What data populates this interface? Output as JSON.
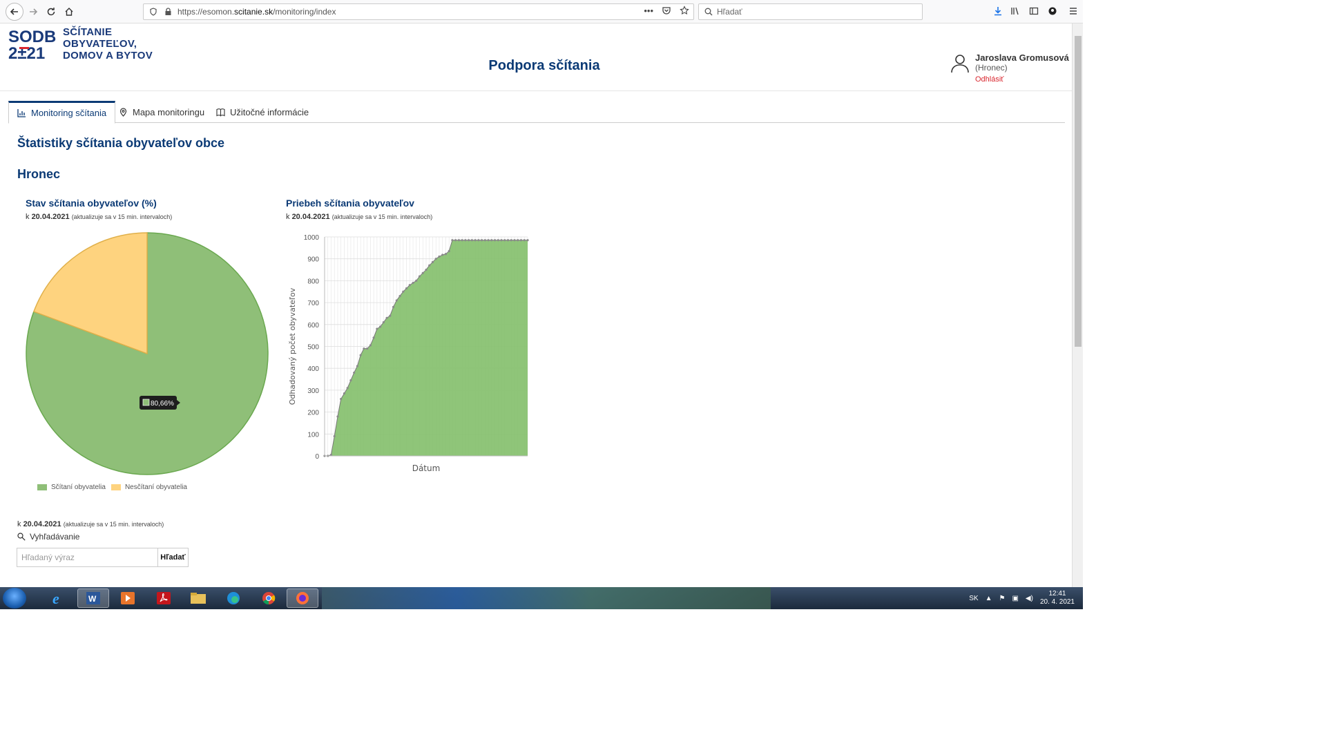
{
  "browser": {
    "url_prefix": "https://esomon.",
    "url_domain": "scitanie.sk",
    "url_path": "/monitoring/index",
    "search_placeholder": "Hľadať"
  },
  "header": {
    "logo_line1": "SODB",
    "logo_line2": "2±21",
    "logo_text_1": "SČÍTANIE",
    "logo_text_2": "OBYVATEĽOV,",
    "logo_text_3": "DOMOV A BYTOV",
    "site_title": "Podpora sčítania",
    "user_name": "Jaroslava Gromusová",
    "user_city": "(Hronec)",
    "logout": "Odhlásiť"
  },
  "tabs": [
    {
      "label": "Monitoring sčítania",
      "icon": "chart-icon"
    },
    {
      "label": "Mapa monitoringu",
      "icon": "map-pin-icon"
    },
    {
      "label": "Užitočné informácie",
      "icon": "book-icon"
    }
  ],
  "page": {
    "heading": "Štatistiky sčítania obyvateľov obce",
    "city": "Hronec"
  },
  "pie_card": {
    "title": "Stav sčítania obyvateľov (%)",
    "date_prefix": "k ",
    "date": "20.04.2021",
    "note": "(aktualizuje sa v 15 min. intervaloch)",
    "tooltip": "80,66%"
  },
  "line_card": {
    "title": "Priebeh sčítania obyvateľov",
    "date_prefix": "k ",
    "date": "20.04.2021",
    "note": "(aktualizuje sa v 15 min. intervaloch)"
  },
  "search_section": {
    "date_prefix": "k ",
    "date": "20.04.2021",
    "note": "(aktualizuje sa v 15 min. intervaloch)",
    "label": "Vyhľadávanie",
    "placeholder": "Hľadaný výraz",
    "button": "Hľadať"
  },
  "taskbar": {
    "lang": "SK",
    "time": "12:41",
    "date": "20. 4. 2021"
  },
  "chart_data": [
    {
      "type": "pie",
      "categories": [
        "Sčítaní obyvatelia",
        "Nesčítaní obyvatelia"
      ],
      "values": [
        80.66,
        19.34
      ],
      "colors": [
        "#8fbf78",
        "#fed37f"
      ],
      "legend": "bottom"
    },
    {
      "type": "area",
      "xlabel": "Dátum",
      "ylabel": "Odhadovaný počet obyvateľov",
      "ylim": [
        0,
        1000
      ],
      "yticks": [
        0,
        100,
        200,
        300,
        400,
        500,
        600,
        700,
        800,
        900,
        1000
      ],
      "color": "#86c06e",
      "series": [
        {
          "values": [
            0,
            0,
            5,
            90,
            180,
            260,
            285,
            310,
            345,
            380,
            410,
            460,
            490,
            490,
            505,
            540,
            580,
            590,
            610,
            630,
            640,
            680,
            710,
            730,
            750,
            765,
            780,
            790,
            800,
            820,
            835,
            850,
            870,
            885,
            900,
            910,
            918,
            922,
            935,
            985,
            985,
            985,
            985,
            985,
            985,
            985,
            985,
            985,
            985,
            985,
            985,
            985,
            985,
            985,
            985,
            985,
            985,
            985,
            985,
            985,
            985,
            985,
            985
          ]
        }
      ]
    }
  ]
}
